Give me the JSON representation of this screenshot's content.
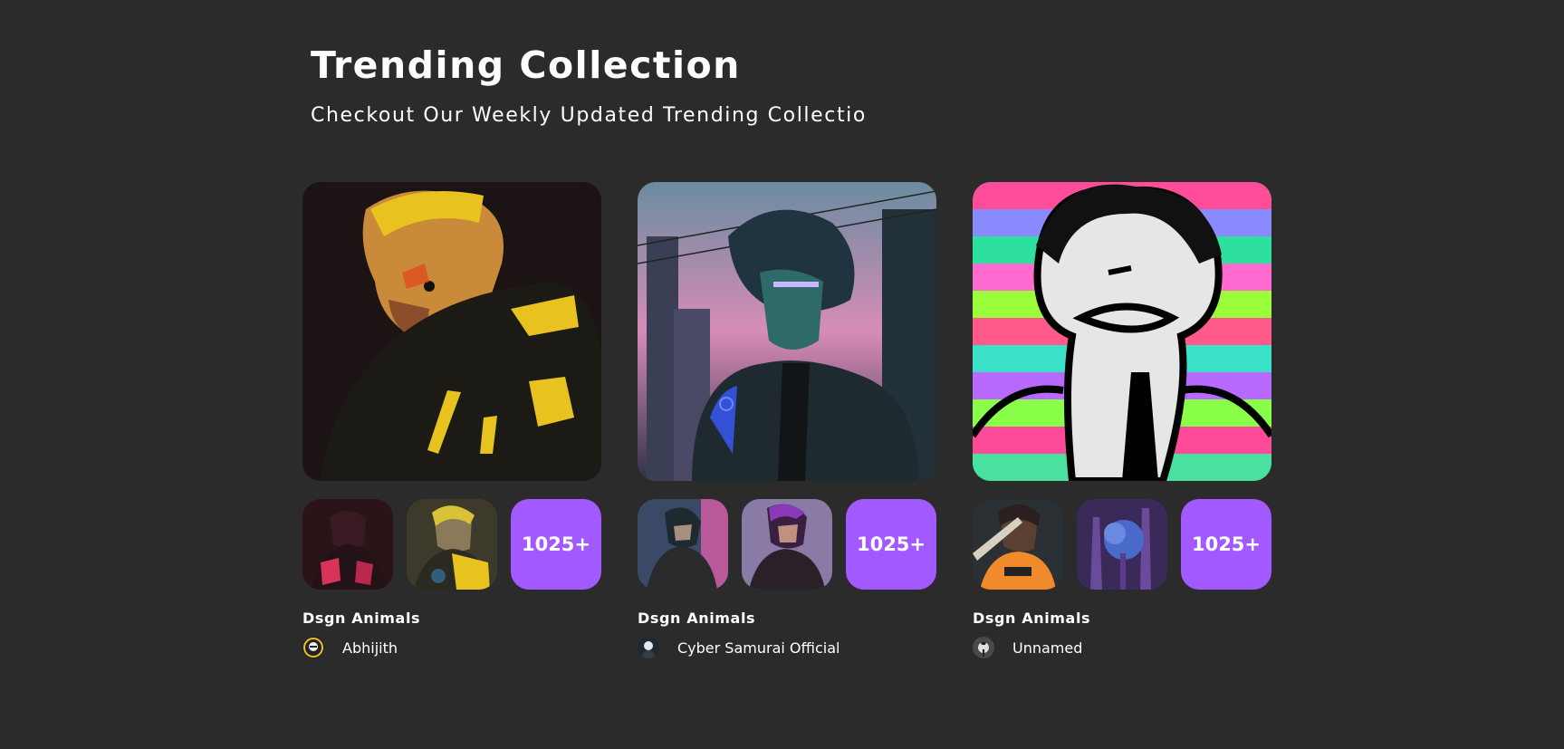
{
  "section": {
    "title": "Trending Collection",
    "subtitle": "Checkout Our Weekly Updated Trending Collectio"
  },
  "colors": {
    "background": "#2b2b2b",
    "accent": "#a259ff",
    "text": "#ffffff"
  },
  "collections": [
    {
      "name": "Dsgn Animals",
      "artist": "Abhijith",
      "count_label": "1025+",
      "hero_image": "cyberpunk-man-yellow-jacket-artwork",
      "thumbs": [
        "cyberpunk-red-figure-thumbnail",
        "cyberpunk-yellow-samurai-thumbnail"
      ],
      "avatar": "artist-avatar"
    },
    {
      "name": "Dsgn Animals",
      "artist": "Cyber Samurai Official",
      "count_label": "1025+",
      "hero_image": "anime-boy-neon-city-rain-artwork",
      "thumbs": [
        "anime-boy-city-thumbnail",
        "anime-boy-purple-hair-thumbnail"
      ],
      "avatar": "artist-avatar"
    },
    {
      "name": "Dsgn Animals",
      "artist": "Unnamed",
      "count_label": "1025+",
      "hero_image": "scribble-face-rainbow-glitch-artwork",
      "thumbs": [
        "monkey-orange-shirt-thumbnail",
        "purple-forest-trees-thumbnail"
      ],
      "avatar": "artist-avatar"
    }
  ]
}
